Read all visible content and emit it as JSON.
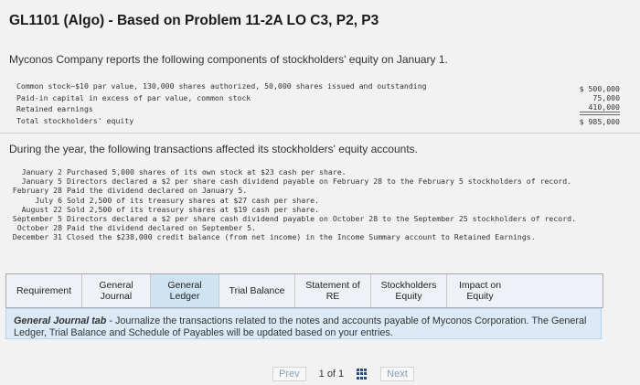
{
  "title": "GL1101 (Algo) - Based on Problem 11-2A LO C3, P2, P3",
  "intro": "Myconos Company reports the following components of stockholders' equity on January 1.",
  "equity": {
    "labels": [
      "Common stock—$10 par value, 130,000 shares authorized, 50,000 shares issued and outstanding",
      "Paid-in capital in excess of par value, common stock",
      "Retained earnings",
      "Total stockholders' equity"
    ],
    "values": [
      "$ 500,000",
      "75,000",
      "410,000",
      "$ 985,000"
    ]
  },
  "during": "During the year, the following transactions affected its stockholders' equity accounts.",
  "transactions": [
    {
      "date": "January 2",
      "text": "Purchased 5,000 shares of its own stock at $23 cash per share."
    },
    {
      "date": "January 5",
      "text": "Directors declared a $2 per share cash dividend payable on February 28 to the February 5 stockholders of record."
    },
    {
      "date": "February 28",
      "text": "Paid the dividend declared on January 5."
    },
    {
      "date": "July 6",
      "text": "Sold 2,500 of its treasury shares at $27 cash per share."
    },
    {
      "date": "August 22",
      "text": "Sold 2,500 of its treasury shares at $19 cash per share."
    },
    {
      "date": "September 5",
      "text": "Directors declared a $2 per share cash dividend payable on October 28 to the September 25 stockholders of record."
    },
    {
      "date": "October 28",
      "text": "Paid the dividend declared on September 5."
    },
    {
      "date": "December 31",
      "text": "Closed the $238,000 credit balance (from net income) in the Income Summary account to Retained Earnings."
    }
  ],
  "tabs": [
    {
      "line1": "Requirement",
      "line2": ""
    },
    {
      "line1": "General",
      "line2": "Journal"
    },
    {
      "line1": "General",
      "line2": "Ledger"
    },
    {
      "line1": "Trial Balance",
      "line2": ""
    },
    {
      "line1": "Statement of",
      "line2": "RE"
    },
    {
      "line1": "Stockholders",
      "line2": "Equity"
    },
    {
      "line1": "Impact on",
      "line2": "Equity"
    }
  ],
  "instruction": {
    "bold": "General Journal tab",
    "text": " - Journalize the transactions related to the notes and accounts payable of Myconos Corporation. The General Ledger, Trial Balance and Schedule of Payables will be updated based on your entries."
  },
  "pager": {
    "prev": "Prev",
    "page": "1",
    "of": "of 1",
    "next": "Next"
  }
}
